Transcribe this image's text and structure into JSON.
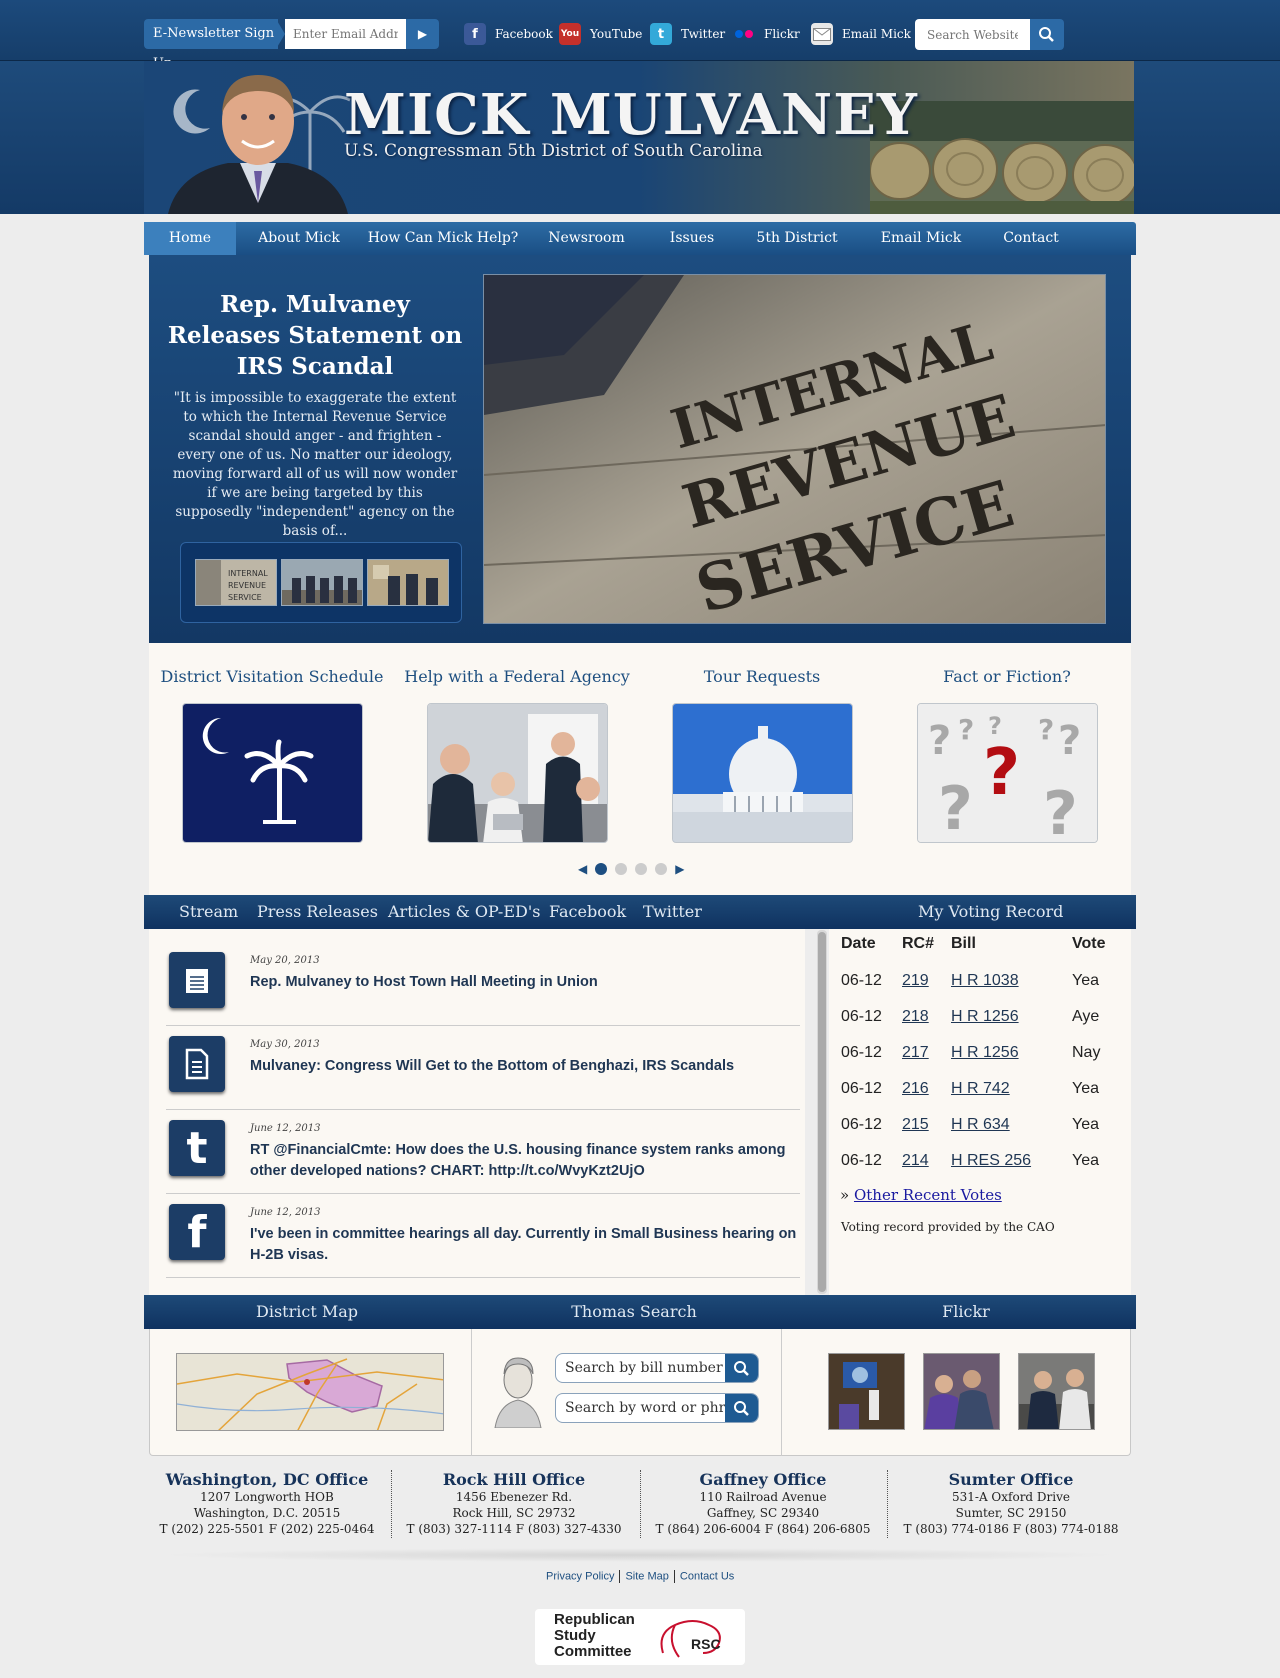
{
  "topbar": {
    "newsletter_label": "E-Newsletter Sign Up",
    "email_placeholder": "Enter Email Addre",
    "social": [
      {
        "label": "Facebook",
        "icon": "facebook-icon"
      },
      {
        "label": "YouTube",
        "icon": "youtube-icon"
      },
      {
        "label": "Twitter",
        "icon": "twitter-icon"
      },
      {
        "label": "Flickr",
        "icon": "flickr-icon"
      },
      {
        "label": "Email Mick",
        "icon": "email-icon"
      }
    ],
    "search_placeholder": "Search Website"
  },
  "banner": {
    "title": "MICK MULVANEY",
    "subtitle": "U.S. Congressman 5th District of South Carolina"
  },
  "nav": [
    "Home",
    "About Mick",
    "How Can Mick Help?",
    "Newsroom",
    "Issues",
    "5th District",
    "Email Mick",
    "Contact"
  ],
  "hero": {
    "title": "Rep. Mulvaney Releases Statement on IRS Scandal",
    "excerpt": "\"It is impossible to exaggerate the extent to which the Internal Revenue Service scandal should anger - and frighten - every one of us. No matter our ideology, moving forward all of us will now wonder if we are being targeted by this supposedly \"independent\" agency on the basis of...",
    "image_lines": [
      "INTERNAL",
      "REVENUE",
      "SERVICE"
    ]
  },
  "services": [
    {
      "title": "District Visitation Schedule"
    },
    {
      "title": "Help with a Federal Agency"
    },
    {
      "title": "Tour Requests"
    },
    {
      "title": "Fact or Fiction?"
    }
  ],
  "pager": {
    "prev": "◀",
    "next": "▶",
    "pages": 4,
    "active": 1
  },
  "tabs": [
    "Stream",
    "Press Releases",
    "Articles & OP-ED's",
    "Facebook",
    "Twitter"
  ],
  "voting_tab": "My Voting Record",
  "stream": [
    {
      "date": "May 20, 2013",
      "title": "Rep. Mulvaney to Host Town Hall Meeting in Union",
      "icon": "notepad-icon"
    },
    {
      "date": "May 30, 2013",
      "title": "Mulvaney: Congress Will Get to the Bottom of Benghazi, IRS Scandals",
      "icon": "document-icon"
    },
    {
      "date": "June 12, 2013",
      "title": "RT @FinancialCmte: How does the U.S. housing finance system ranks among other developed nations? CHART: http://t.co/WvyKzt2UjO",
      "icon": "twitter-icon"
    },
    {
      "date": "June 12, 2013",
      "title": "I've been in committee hearings all day. Currently in Small Business hearing on H-2B visas.",
      "icon": "facebook-icon"
    }
  ],
  "voting": {
    "headers": [
      "Date",
      "RC#",
      "Bill",
      "Vote"
    ],
    "rows": [
      [
        "06-12",
        "219",
        "H R 1038",
        "Yea"
      ],
      [
        "06-12",
        "218",
        "H R 1256",
        "Aye"
      ],
      [
        "06-12",
        "217",
        "H R 1256",
        "Nay"
      ],
      [
        "06-12",
        "216",
        "H R 742",
        "Yea"
      ],
      [
        "06-12",
        "215",
        "H R 634",
        "Yea"
      ],
      [
        "06-12",
        "214",
        "H RES 256",
        "Yea"
      ]
    ],
    "other_prefix": "»",
    "other_link": "Other Recent Votes",
    "note": "Voting record provided by the CAO"
  },
  "bottom_tabs": [
    "District Map",
    "Thomas Search",
    "Flickr"
  ],
  "thomas": {
    "bill_placeholder": "Search by bill number",
    "word_placeholder": "Search by word or phrase"
  },
  "offices": [
    {
      "name": "Washington, DC Office",
      "line1": "1207 Longworth HOB",
      "line2": "Washington, D.C. 20515",
      "line3": "T (202) 225-5501 F (202) 225-0464"
    },
    {
      "name": "Rock Hill Office",
      "line1": "1456 Ebenezer Rd.",
      "line2": "Rock Hill, SC 29732",
      "line3": "T (803) 327-1114 F (803) 327-4330"
    },
    {
      "name": "Gaffney Office",
      "line1": "110 Railroad Avenue",
      "line2": "Gaffney, SC 29340",
      "line3": "T (864) 206-6004 F (864) 206-6805"
    },
    {
      "name": "Sumter Office",
      "line1": "531-A Oxford Drive",
      "line2": "Sumter, SC 29150",
      "line3": "T (803) 774-0186 F (803) 774-0188"
    }
  ],
  "footer": {
    "links": [
      "Privacy Policy",
      "Site Map",
      "Contact Us"
    ]
  },
  "rsc": {
    "line1": "Republican",
    "line2": "Study",
    "line3": "Committee",
    "badge": "RSC"
  },
  "colors": {
    "navy": "#133864",
    "accent": "#2c6aa6",
    "paper": "#fbf8f3"
  }
}
